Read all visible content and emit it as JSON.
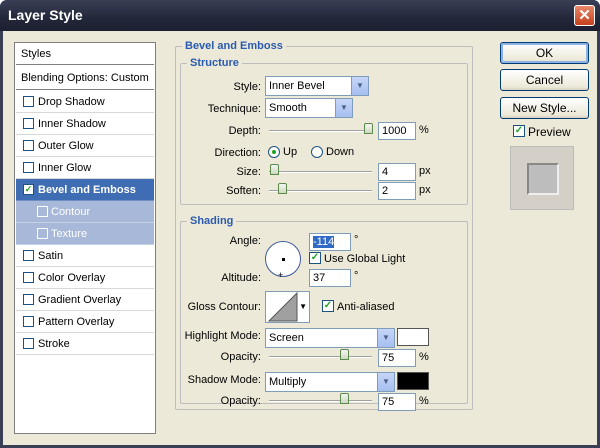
{
  "window": {
    "title": "Layer Style",
    "close_glyph": "✕"
  },
  "styles_list": {
    "header": "Styles",
    "blending": "Blending Options: Custom",
    "items": [
      {
        "label": "Drop Shadow",
        "checked": false
      },
      {
        "label": "Inner Shadow",
        "checked": false
      },
      {
        "label": "Outer Glow",
        "checked": false
      },
      {
        "label": "Inner Glow",
        "checked": false
      },
      {
        "label": "Bevel and Emboss",
        "checked": true,
        "selected": true
      },
      {
        "label": "Contour",
        "checked": false,
        "sub": true
      },
      {
        "label": "Texture",
        "checked": false,
        "sub": true
      },
      {
        "label": "Satin",
        "checked": false
      },
      {
        "label": "Color Overlay",
        "checked": false
      },
      {
        "label": "Gradient Overlay",
        "checked": false
      },
      {
        "label": "Pattern Overlay",
        "checked": false
      },
      {
        "label": "Stroke",
        "checked": false
      }
    ]
  },
  "bevel": {
    "title": "Bevel and Emboss",
    "structure": {
      "title": "Structure",
      "style_label": "Style:",
      "style_value": "Inner Bevel",
      "technique_label": "Technique:",
      "technique_value": "Smooth",
      "depth_label": "Depth:",
      "depth_value": "1000",
      "depth_unit": "%",
      "direction_label": "Direction:",
      "dir_up": "Up",
      "dir_down": "Down",
      "size_label": "Size:",
      "size_value": "4",
      "size_unit": "px",
      "soften_label": "Soften:",
      "soften_value": "2",
      "soften_unit": "px"
    },
    "shading": {
      "title": "Shading",
      "angle_label": "Angle:",
      "angle_value": "-114",
      "angle_unit": "°",
      "global_light": "Use Global Light",
      "altitude_label": "Altitude:",
      "altitude_value": "37",
      "altitude_unit": "°",
      "gloss_label": "Gloss Contour:",
      "antialiased": "Anti-aliased",
      "highlight_label": "Highlight Mode:",
      "highlight_value": "Screen",
      "highlight_color": "#ffffff",
      "hl_opacity_label": "Opacity:",
      "hl_opacity_value": "75",
      "hl_opacity_unit": "%",
      "shadow_label": "Shadow Mode:",
      "shadow_value": "Multiply",
      "shadow_color": "#000000",
      "sh_opacity_label": "Opacity:",
      "sh_opacity_value": "75",
      "sh_opacity_unit": "%"
    }
  },
  "buttons": {
    "ok": "OK",
    "cancel": "Cancel",
    "new_style": "New Style...",
    "preview": "Preview"
  }
}
